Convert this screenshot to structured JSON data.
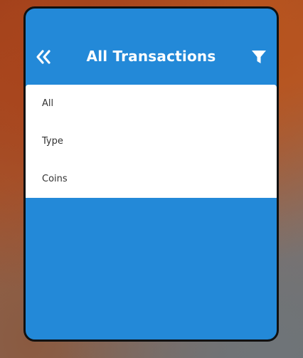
{
  "header": {
    "title": "All Transactions",
    "back_icon": "double-chevron-left-icon",
    "filter_icon": "filter-icon"
  },
  "filter_menu": {
    "items": [
      {
        "label": "All"
      },
      {
        "label": "Type"
      },
      {
        "label": "Coins"
      }
    ]
  },
  "colors": {
    "primary": "#2389d8",
    "menu_background": "#ffffff",
    "menu_text": "#333333",
    "header_text": "#ffffff",
    "frame_border": "#111111"
  }
}
